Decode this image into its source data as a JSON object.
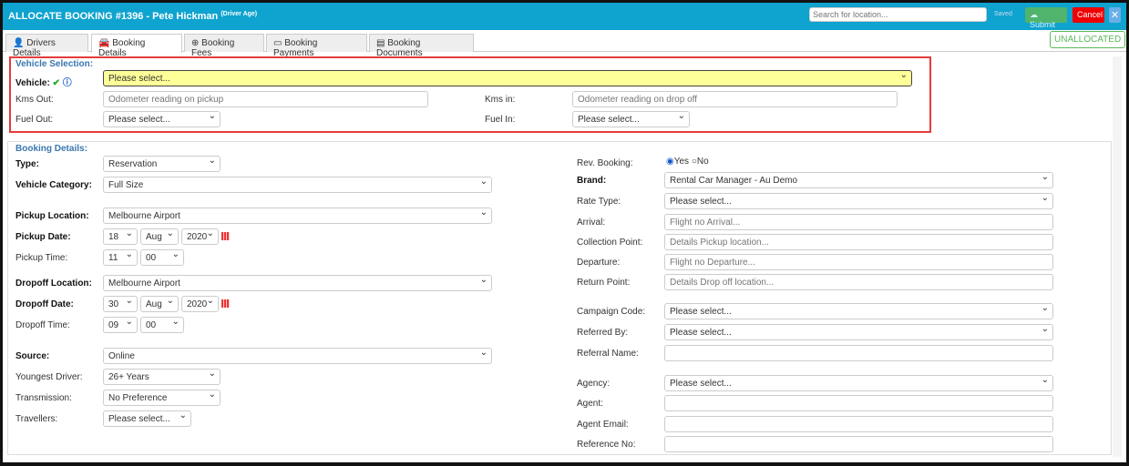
{
  "header": {
    "title": "ALLOCATE BOOKING #1396 - Pete Hickman",
    "subtitle": "(Driver Age)",
    "search_placeholder": "Search for location...",
    "saved": "Saved",
    "submit": "Submit",
    "cancel": "Cancel",
    "close": "✕"
  },
  "tabs": [
    "Drivers Details",
    "Booking Details",
    "Booking Fees",
    "Booking Payments",
    "Booking Documents"
  ],
  "status": "UNALLOCATED",
  "vehicle": {
    "section": "Vehicle Selection:",
    "vehicle_label": "Vehicle:",
    "vehicle_value": "Please select...",
    "kms_out_label": "Kms Out:",
    "kms_out_placeholder": "Odometer reading on pickup",
    "kms_in_label": "Kms in:",
    "kms_in_placeholder": "Odometer reading on drop off",
    "fuel_out_label": "Fuel Out:",
    "fuel_out_value": "Please select...",
    "fuel_in_label": "Fuel In:",
    "fuel_in_value": "Please select..."
  },
  "booking": {
    "section": "Booking Details:",
    "type_label": "Type:",
    "type": "Reservation",
    "category_label": "Vehicle Category:",
    "category": "Full Size",
    "pickup_loc_label": "Pickup Location:",
    "pickup_loc": "Melbourne Airport",
    "pickup_date_label": "Pickup Date:",
    "pickup_day": "18",
    "pickup_month": "Aug",
    "pickup_year": "2020",
    "pickup_time_label": "Pickup Time:",
    "pickup_hour": "11",
    "pickup_min": "00",
    "dropoff_loc_label": "Dropoff Location:",
    "dropoff_loc": "Melbourne Airport",
    "dropoff_date_label": "Dropoff Date:",
    "dropoff_day": "30",
    "dropoff_month": "Aug",
    "dropoff_year": "2020",
    "dropoff_time_label": "Dropoff Time:",
    "dropoff_hour": "09",
    "dropoff_min": "00",
    "source_label": "Source:",
    "source": "Online",
    "youngest_label": "Youngest Driver:",
    "youngest": "26+ Years",
    "transmission_label": "Transmission:",
    "transmission": "No Preference",
    "travellers_label": "Travellers:",
    "travellers": "Please select...",
    "rev_label": "Rev. Booking:",
    "rev_yes": "Yes",
    "rev_no": "No",
    "brand_label": "Brand:",
    "brand": "Rental Car Manager - Au Demo",
    "rate_label": "Rate Type:",
    "rate": "Please select...",
    "arrival_label": "Arrival:",
    "arrival_ph": "Flight no Arrival...",
    "collection_label": "Collection Point:",
    "collection_ph": "Details Pickup location...",
    "departure_label": "Departure:",
    "departure_ph": "Flight no Departure...",
    "return_label": "Return Point:",
    "return_ph": "Details Drop off location...",
    "campaign_label": "Campaign Code:",
    "campaign": "Please select...",
    "referred_label": "Referred By:",
    "referred": "Please select...",
    "refname_label": "Referral Name:",
    "agency_label": "Agency:",
    "agency": "Please select...",
    "agent_label": "Agent:",
    "agent_email_label": "Agent Email:",
    "reference_label": "Reference No:"
  }
}
